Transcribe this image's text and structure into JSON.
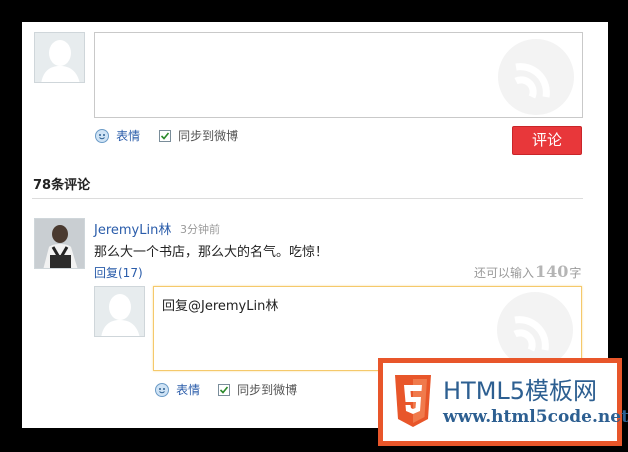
{
  "composer": {
    "emoticon_label": "表情",
    "sync_label": "同步到微博",
    "sync_checked": true,
    "submit_label": "评论"
  },
  "comments_header": {
    "title": "78条评论"
  },
  "comment": {
    "username": "JeremyLin林",
    "time": "3分钟前",
    "text": "那么大一个书店，那么大的名气。吃惊！",
    "reply_link": "回复(17)"
  },
  "reply_box": {
    "remaining_prefix": "还可以输入",
    "remaining_count": "140",
    "remaining_suffix": "字",
    "text": "回复@JeremyLin林",
    "emoticon_label": "表情",
    "sync_label": "同步到微博",
    "sync_checked": true
  },
  "watermark": {
    "brand": "HTML5模板网",
    "url": "www.html5code.net",
    "accent": "#e8562a"
  }
}
